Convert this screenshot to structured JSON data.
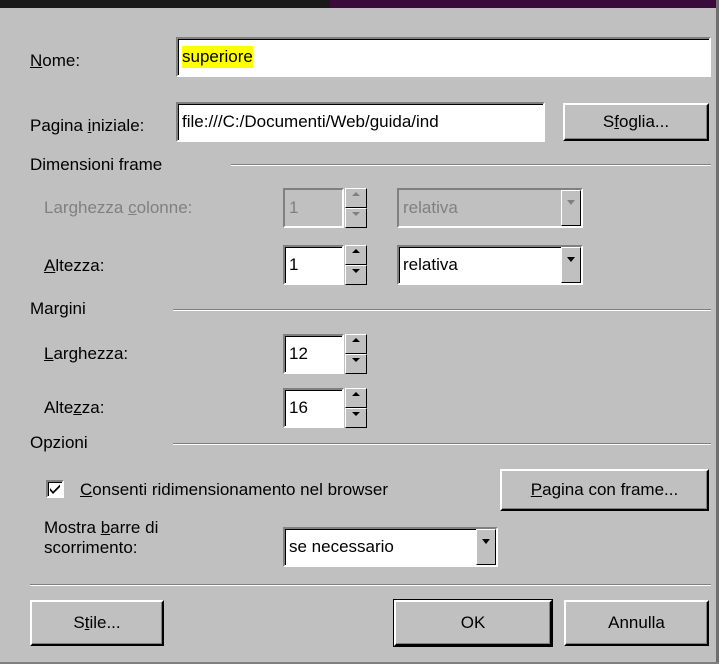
{
  "form": {
    "nome": {
      "label": "Nome:",
      "value": "superiore"
    },
    "pagina_iniziale": {
      "label": "Pagina iniziale:",
      "value": "file:///C:/Documenti/Web/guida/ind",
      "browse_button": "Sfoglia..."
    },
    "dimensioni_frame": {
      "section_title": "Dimensioni frame",
      "larghezza_colonne": {
        "label": "Larghezza colonne:",
        "value": "1",
        "unit": "relativa",
        "disabled": true
      },
      "altezza": {
        "label": "Altezza:",
        "value": "1",
        "unit": "relativa"
      }
    },
    "margini": {
      "section_title": "Margini",
      "larghezza": {
        "label": "Larghezza:",
        "value": "12"
      },
      "altezza": {
        "label": "Altezza:",
        "value": "16"
      }
    },
    "opzioni": {
      "section_title": "Opzioni",
      "resize_checkbox": {
        "label": "Consenti ridimensionamento nel browser",
        "checked": true
      },
      "frameset_button": "Pagina con frame...",
      "scrollbars": {
        "label_line1": "Mostra barre di",
        "label_line2": "scorrimento:",
        "value": "se necessario"
      }
    }
  },
  "buttons": {
    "style": "Stile...",
    "ok": "OK",
    "cancel": "Annulla"
  },
  "colors": {
    "dialog_bg": "#c0c0c0",
    "highlight": "#ffff00",
    "disabled_text": "#808080"
  }
}
